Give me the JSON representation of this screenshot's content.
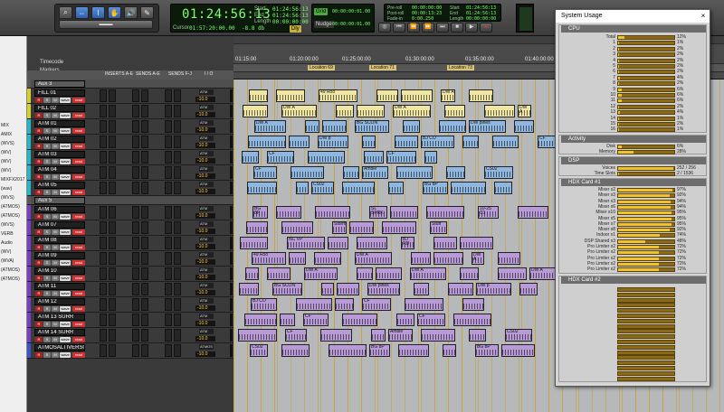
{
  "counter": {
    "main": "01:24:56:13",
    "cursor_label": "Cursor",
    "cursor_value": "01:57:20:00.00",
    "cursor_db": "-8.8 db",
    "start_label": "Start",
    "start_value": "01:24:56:13",
    "end_label": "End",
    "end_value": "01:24:56:13",
    "length_label": "Length",
    "length_value": "00:00:00:00",
    "dly_label": "Dly"
  },
  "grid": {
    "grid_label": "Grid",
    "grid_value": "00:00:00:01.00",
    "nudge_label": "Nudge",
    "nudge_value": "00:00:00:01.00"
  },
  "preroll": {
    "preroll_label": "Pre-roll",
    "preroll_value": "00:00:00:00",
    "postroll_label": "Post-roll",
    "postroll_value": "00:00:13:23",
    "fadein_label": "Fade-in",
    "fadein_value": "0:00.250",
    "start_label": "Start",
    "start_value": "01:24:56:13",
    "end_label": "End",
    "end_value": "01:24:56:13",
    "length_label": "Length",
    "length_value": "00:00:00:00"
  },
  "left_list": [
    "MIX",
    "AMIX",
    "(WVS)",
    "(WV)",
    "(WV)",
    "(WV)",
    "MIXFX2017",
    "(wav)",
    "(WVS)",
    "(ATMOS)",
    "(ATMOS)",
    "(WVS)",
    "VERB",
    "Audio",
    "(WV)",
    "(WVA)",
    "(ATMOS)",
    "(ATMOS)"
  ],
  "col_headers": {
    "inserts": "INSERTS A-E",
    "sends": "SENDS A-E",
    "sends2": "SENDS F-J",
    "io": "I / O"
  },
  "ruler": {
    "timecode_label": "Timecode",
    "markers_label": "Markers",
    "ticks": [
      "01:15:00",
      "01:20:00:00",
      "01:25:00:00",
      "01:30:00:00",
      "01:35:00:00",
      "01:40:00:00"
    ],
    "locations": [
      "Location 69",
      "Location 71",
      "Location 73"
    ]
  },
  "tracks": [
    {
      "name": "Aux 3",
      "aux": true,
      "color": "#5a5a5a"
    },
    {
      "name": "FILL 01",
      "color": "#d6cf2a",
      "io": "ATM",
      "vol": "-10.0"
    },
    {
      "name": "FILL 02",
      "color": "#d6cf2a",
      "io": "ATM",
      "vol": "-10.0"
    },
    {
      "name": "ATM 01",
      "color": "#29b6c4",
      "io": "ATM",
      "vol": "-10.0"
    },
    {
      "name": "ATM 02",
      "color": "#29b6c4",
      "io": "ATM",
      "vol": "-10.0"
    },
    {
      "name": "ATM 03",
      "color": "#29b6c4",
      "io": "ATM",
      "vol": "-10.0"
    },
    {
      "name": "ATM 04",
      "color": "#29b6c4",
      "io": "ATM",
      "vol": "-10.0"
    },
    {
      "name": "ATM 05",
      "color": "#29b6c4",
      "io": "ATM",
      "vol": "-10.0"
    },
    {
      "name": "Aux 5",
      "aux": true,
      "color": "#5a5a5a"
    },
    {
      "name": "ATM 06",
      "color": "#7a3fc0",
      "io": "ATM",
      "vol": "-10.0"
    },
    {
      "name": "ATM 07",
      "color": "#7a3fc0",
      "io": "ATM",
      "vol": "-10.0"
    },
    {
      "name": "ATM 08",
      "color": "#7a3fc0",
      "io": "ATM",
      "vol": "-10.0"
    },
    {
      "name": "ATM 09",
      "color": "#7a3fc0",
      "io": "ATM",
      "vol": "-10.0"
    },
    {
      "name": "ATM 10",
      "color": "#7a3fc0",
      "io": "ATM",
      "vol": "-10.0"
    },
    {
      "name": "ATM 11",
      "color": "#7a3fc0",
      "io": "ATM",
      "vol": "-10.0"
    },
    {
      "name": "ATM 12",
      "color": "#7a3fc0",
      "io": "ATM",
      "vol": "-10.0"
    },
    {
      "name": "ATM 13 SURR",
      "color": "#7a3fc0",
      "io": "ATM",
      "vol": "-10.0"
    },
    {
      "name": "ATM 14 SURR",
      "color": "#7a3fc0",
      "io": "ATM",
      "vol": "-10.0"
    },
    {
      "name": "ATMOSALTIVERS0",
      "color": "#3a55c4",
      "io": "ATMOS",
      "vol": "-10.0"
    }
  ],
  "track_buttons": {
    "r": "R",
    "s": "S",
    "m": "M",
    "wave": "wave",
    "read": "read"
  },
  "system_usage": {
    "title": "System Usage",
    "close": "×",
    "cpu_title": "CPU",
    "cpu_rows": [
      {
        "label": "Total",
        "pct": 12
      },
      {
        "label": "1",
        "pct": 1
      },
      {
        "label": "2",
        "pct": 2
      },
      {
        "label": "3",
        "pct": 2
      },
      {
        "label": "4",
        "pct": 2
      },
      {
        "label": "5",
        "pct": 2
      },
      {
        "label": "6",
        "pct": 2
      },
      {
        "label": "7",
        "pct": 4
      },
      {
        "label": "8",
        "pct": 2
      },
      {
        "label": "9",
        "pct": 6
      },
      {
        "label": "10",
        "pct": 6
      },
      {
        "label": "11",
        "pct": 6
      },
      {
        "label": "12",
        "pct": 2
      },
      {
        "label": "13",
        "pct": 4
      },
      {
        "label": "14",
        "pct": 1
      },
      {
        "label": "15",
        "pct": 2
      },
      {
        "label": "16",
        "pct": 1
      }
    ],
    "activity_title": "Activity",
    "activity_rows": [
      {
        "label": "Disk",
        "pct": 6
      },
      {
        "label": "Memory",
        "pct": 28
      }
    ],
    "dsp_title": "DSP",
    "dsp_rows": [
      {
        "label": "Voices",
        "value": "252 / 256",
        "pct": 98
      },
      {
        "label": "Time Slots",
        "value": "2 / 1536",
        "pct": 1
      }
    ],
    "hdx1_title": "HDX Card #1",
    "hdx1_rows": [
      {
        "label": "Mixer x2",
        "pct": 97
      },
      {
        "label": "Mixer x3",
        "pct": 92
      },
      {
        "label": "Mixer x3",
        "pct": 94
      },
      {
        "label": "Mixer x6",
        "pct": 94
      },
      {
        "label": "Mixer x10",
        "pct": 95
      },
      {
        "label": "Mixer x5",
        "pct": 95
      },
      {
        "label": "Mixer x7",
        "pct": 95
      },
      {
        "label": "Mixer x8",
        "pct": 92
      },
      {
        "label": "Indoor x1",
        "pct": 74
      },
      {
        "label": "DSP Shared x3",
        "pct": 48
      },
      {
        "label": "Pro Limiter x2",
        "pct": 72
      },
      {
        "label": "Pro Limiter x2",
        "pct": 72
      },
      {
        "label": "Pro Limiter x2",
        "pct": 72
      },
      {
        "label": "Pro Limiter x2",
        "pct": 72
      },
      {
        "label": "Pro Limiter x2",
        "pct": 72
      }
    ],
    "hdx2_title": "HDX Card #2",
    "hdx2_bar_count": 18
  },
  "colors": {
    "clip_blue": "#8fb7e0",
    "clip_yellow": "#efe6a3",
    "clip_purple": "#b79ad6",
    "counter_green": "#7dff6e",
    "meter_gold": "#f0c230"
  },
  "clip_labels": [
    "49 Roo",
    "DW A",
    "DW A",
    "DW A",
    "DW A",
    "DW A",
    "BG SCON",
    "DW pines",
    "DW p",
    "BJ CO",
    "CF",
    "CF",
    "CF",
    "CF",
    "Ambie",
    "CS02",
    "CS02",
    "BG 8P",
    "BG 8P",
    "SL SPRK",
    "10-25 C1",
    "Storm",
    "Stuff",
    "NC VP",
    "BJ RD"
  ]
}
